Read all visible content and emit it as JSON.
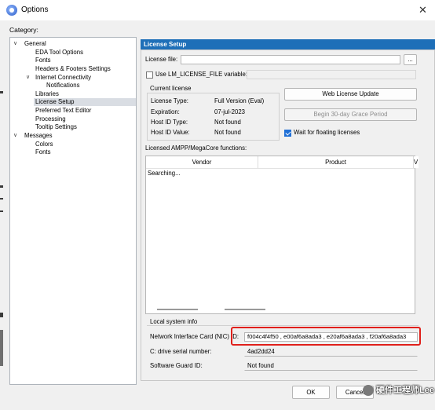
{
  "window": {
    "title": "Options",
    "close_glyph": "✕"
  },
  "category_label": "Category:",
  "tree": [
    {
      "label": "General",
      "toggle": "v",
      "level": 0
    },
    {
      "label": "EDA Tool Options",
      "level": 1
    },
    {
      "label": "Fonts",
      "level": 1
    },
    {
      "label": "Headers & Footers Settings",
      "level": 1
    },
    {
      "label": "Internet Connectivity",
      "toggle": "v",
      "level": 1
    },
    {
      "label": "Notifications",
      "level": 2
    },
    {
      "label": "Libraries",
      "level": 1
    },
    {
      "label": "License Setup",
      "level": 1,
      "selected": true
    },
    {
      "label": "Preferred Text Editor",
      "level": 1
    },
    {
      "label": "Processing",
      "level": 1
    },
    {
      "label": "Tooltip Settings",
      "level": 1
    },
    {
      "label": "Messages",
      "toggle": "v",
      "level": 0
    },
    {
      "label": "Colors",
      "level": 1
    },
    {
      "label": "Fonts",
      "level": 1
    }
  ],
  "panel": {
    "header": "License Setup",
    "license_file_label": "License file:",
    "license_file_value": "",
    "browse_label": "...",
    "use_env_label": "Use LM_LICENSE_FILE variable:",
    "use_env_checked": false,
    "env_value": "",
    "current_license_title": "Current license",
    "current_license": [
      {
        "label": "License Type:",
        "value": "Full Version (Eval)"
      },
      {
        "label": "Expiration:",
        "value": "07-jul-2023"
      },
      {
        "label": "Host ID Type:",
        "value": "Not found"
      },
      {
        "label": "Host ID Value:",
        "value": "Not found"
      }
    ],
    "web_license_update_label": "Web License Update",
    "grace_period_label": "Begin 30-day Grace Period",
    "wait_floating_label": "Wait for floating licenses",
    "wait_floating_checked": true,
    "functions_title": "Licensed AMPP/MegaCore functions:",
    "functions_columns": [
      "Vendor",
      "Product",
      "V"
    ],
    "functions_status": "Searching...",
    "local_info_title": "Local system info",
    "nic_label": "Network Interface Card (NIC) ID:",
    "nic_value": "f004c4f4f50 , e00af6a8ada3 , e20af6a8ada3 , f20af6a8ada3",
    "drive_label": "C: drive serial number:",
    "drive_value": "4ad2dd24",
    "sgid_label": "Software Guard ID:",
    "sgid_value": "Not found"
  },
  "buttons": {
    "ok": "OK",
    "cancel": "Cancel"
  },
  "watermark": "硬件工程师Lee",
  "colors": {
    "header_blue": "#1e6fb8",
    "highlight_red": "#e0201b",
    "checkbox_blue": "#1f6fd6"
  }
}
